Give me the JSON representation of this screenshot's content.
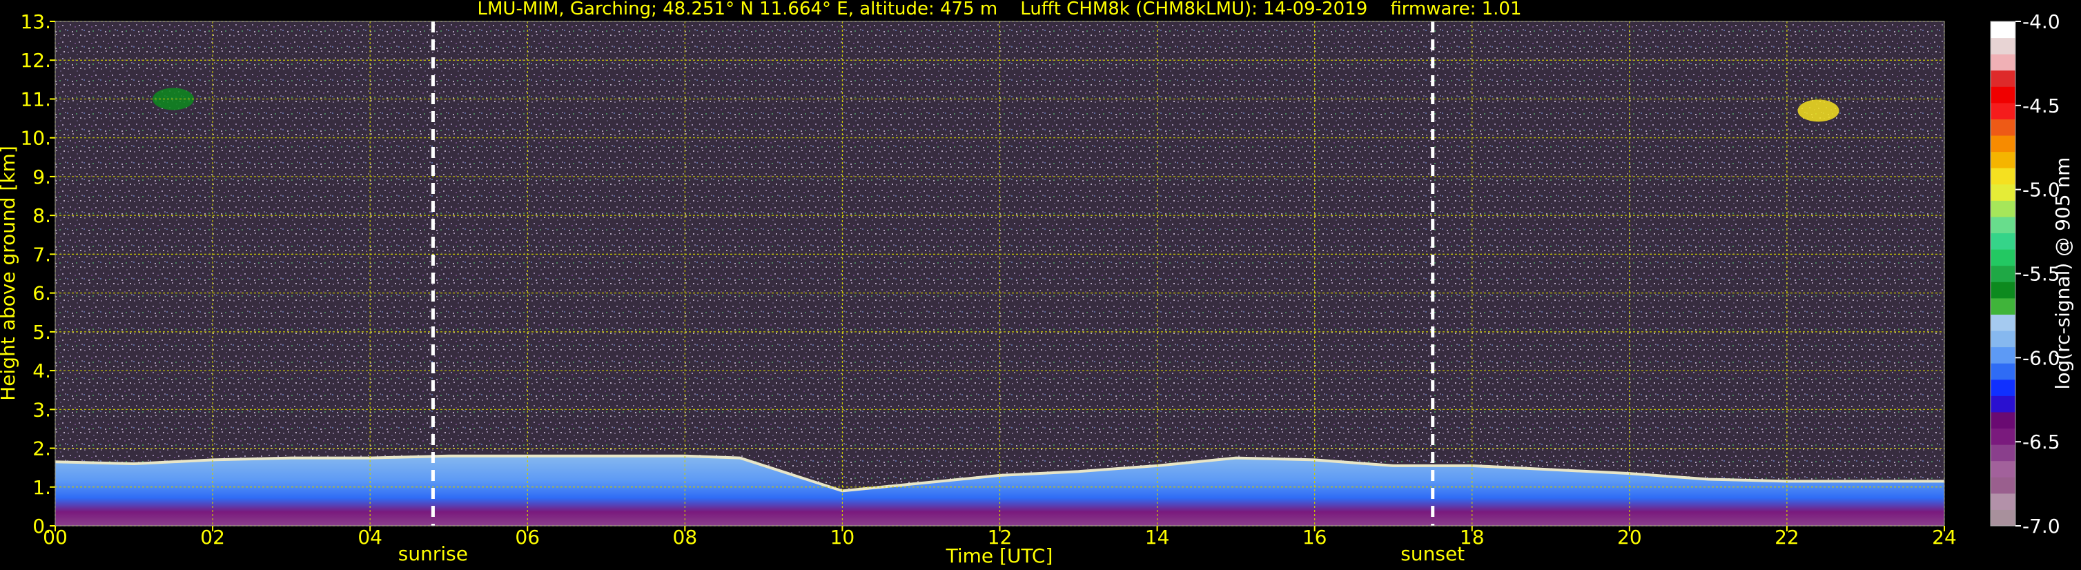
{
  "chart_data": {
    "type": "heatmap",
    "title": "LMU-MIM, Garching; 48.251° N 11.664° E, altitude: 475 m    Lufft CHM8k (CHM8kLMU): 14-09-2019    firmware: 1.01",
    "xlabel": "Time [UTC]",
    "ylabel": "Height above ground [km]",
    "xlim": [
      0,
      24
    ],
    "ylim": [
      0,
      13
    ],
    "x_ticks": [
      "00",
      "02",
      "04",
      "06",
      "08",
      "10",
      "12",
      "14",
      "16",
      "18",
      "20",
      "22",
      "24"
    ],
    "y_ticks": [
      "0.",
      "1.",
      "2.",
      "3.",
      "4.",
      "5.",
      "6.",
      "7.",
      "8.",
      "9.",
      "10.",
      "11.",
      "12.",
      "13."
    ],
    "grid": true,
    "markers": [
      {
        "label": "sunrise",
        "x": 4.8
      },
      {
        "label": "sunset",
        "x": 17.5
      }
    ],
    "colorbar": {
      "label": "log(rc-signal) @ 905 nm",
      "min": -7.0,
      "max": -4.0,
      "ticks": [
        "-4.0",
        "-4.5",
        "-5.0",
        "-5.5",
        "-6.0",
        "-6.5",
        "-7.0"
      ],
      "tick_values": [
        -4.0,
        -4.5,
        -5.0,
        -5.5,
        -6.0,
        -6.5,
        -7.0
      ],
      "colors": [
        "#a8909c",
        "#b391a9",
        "#9a5f8e",
        "#a2619b",
        "#8a3f8c",
        "#7a1a7d",
        "#6a0a72",
        "#2a10d0",
        "#1030ff",
        "#2f6cf5",
        "#5d9af5",
        "#86b8ef",
        "#a5caf0",
        "#40b43a",
        "#0d8a1e",
        "#1fa845",
        "#23c862",
        "#35d489",
        "#68dd8c",
        "#a6e65a",
        "#e5ec37",
        "#f5e020",
        "#f5b400",
        "#f78b00",
        "#ee5a16",
        "#f51c1c",
        "#f00000",
        "#de2a2a",
        "#f0b0b5",
        "#e8d4d4",
        "#ffffff"
      ]
    },
    "boundary_layer_top": [
      {
        "x": 0,
        "y": 1.65
      },
      {
        "x": 1,
        "y": 1.6
      },
      {
        "x": 2,
        "y": 1.7
      },
      {
        "x": 3,
        "y": 1.75
      },
      {
        "x": 4,
        "y": 1.75
      },
      {
        "x": 5,
        "y": 1.8
      },
      {
        "x": 6,
        "y": 1.8
      },
      {
        "x": 7,
        "y": 1.8
      },
      {
        "x": 8,
        "y": 1.8
      },
      {
        "x": 8.7,
        "y": 1.75
      },
      {
        "x": 10,
        "y": 0.9
      },
      {
        "x": 11,
        "y": 1.1
      },
      {
        "x": 12,
        "y": 1.3
      },
      {
        "x": 13,
        "y": 1.4
      },
      {
        "x": 14,
        "y": 1.55
      },
      {
        "x": 15,
        "y": 1.75
      },
      {
        "x": 16,
        "y": 1.7
      },
      {
        "x": 17,
        "y": 1.55
      },
      {
        "x": 18,
        "y": 1.55
      },
      {
        "x": 19,
        "y": 1.45
      },
      {
        "x": 20,
        "y": 1.35
      },
      {
        "x": 21,
        "y": 1.2
      },
      {
        "x": 22,
        "y": 1.15
      },
      {
        "x": 23,
        "y": 1.15
      },
      {
        "x": 24,
        "y": 1.15
      }
    ],
    "cirrus_patches": [
      {
        "x": 22.4,
        "y": 10.7,
        "value": -4.9
      },
      {
        "x": 1.5,
        "y": 11.0,
        "value": -5.6
      }
    ]
  }
}
